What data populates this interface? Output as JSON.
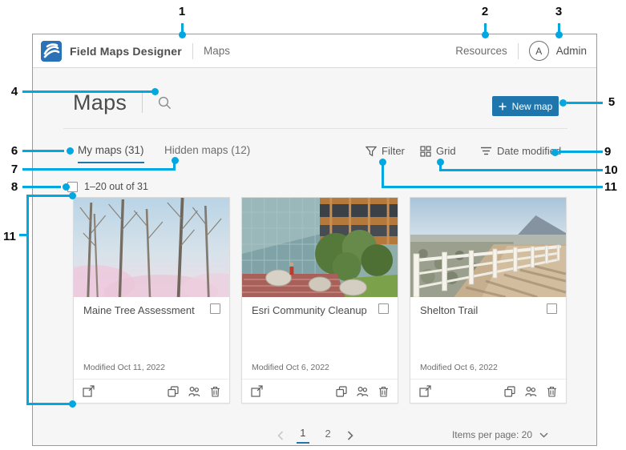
{
  "header": {
    "app_title": "Field Maps Designer",
    "breadcrumb": "Maps",
    "resources_label": "Resources",
    "avatar_initial": "A",
    "user_label": "Admin"
  },
  "toolbar": {
    "page_title": "Maps",
    "new_map_label": "New map"
  },
  "tabs": {
    "my_maps": "My maps (31)",
    "hidden_maps": "Hidden maps (12)"
  },
  "list_controls": {
    "filter_label": "Filter",
    "view_label": "Grid",
    "sort_label": "Date modified"
  },
  "selection_bar": {
    "label": "1–20 out of 31"
  },
  "cards": [
    {
      "title": "Maine Tree Assessment",
      "modified": "Modified Oct 11, 2022"
    },
    {
      "title": "Esri Community Cleanup",
      "modified": "Modified Oct 6, 2022"
    },
    {
      "title": "Shelton Trail",
      "modified": "Modified Oct 6, 2022"
    }
  ],
  "pagination": {
    "pages": [
      "1",
      "2"
    ],
    "items_per_page": "Items per page: 20"
  },
  "callouts": {
    "n1": "1",
    "n2": "2",
    "n3": "3",
    "n4": "4",
    "n5": "5",
    "n6": "6",
    "n7": "7",
    "n8": "8",
    "n9": "9",
    "n10": "10",
    "n11": "11"
  },
  "icons": {
    "logo": "esri-logo",
    "search": "magnifier",
    "new_map": "plus",
    "filter": "funnel",
    "view": "grid-2x2",
    "sort": "sort-lines",
    "open": "open-in-new",
    "duplicate": "copy",
    "share": "people",
    "delete": "trash",
    "prev": "chevron-left",
    "next": "chevron-right",
    "items_per_page": "chevron-down",
    "avatar": "circle-a"
  },
  "colors": {
    "callout_blue": "#00a7e0",
    "button_blue": "#1f76ad",
    "content_background": "#f6f6f6"
  }
}
